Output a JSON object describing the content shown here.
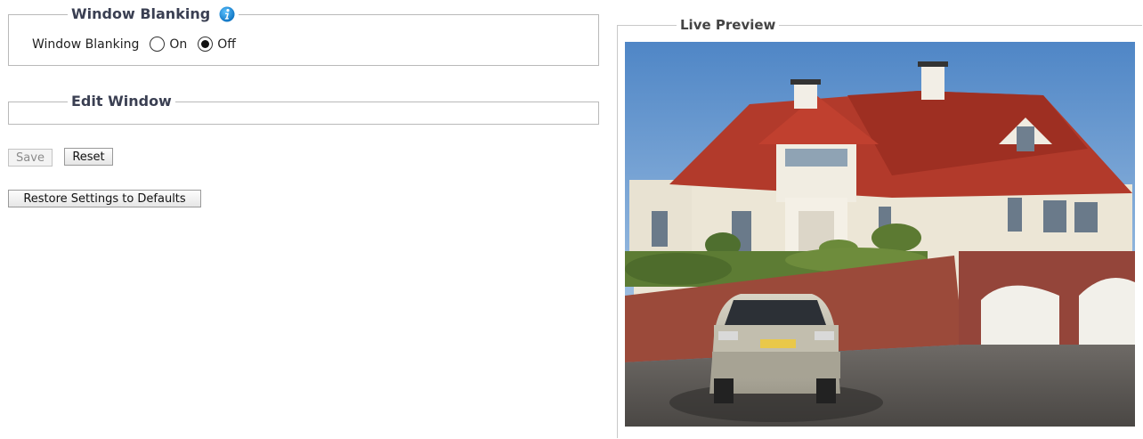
{
  "window_blanking": {
    "legend": "Window Blanking",
    "info_icon": "info-icon",
    "row_label": "Window Blanking",
    "options": [
      {
        "label": "On",
        "selected": false
      },
      {
        "label": "Off",
        "selected": true
      }
    ]
  },
  "edit_window": {
    "legend": "Edit Window"
  },
  "buttons": {
    "save": "Save",
    "reset": "Reset",
    "restore": "Restore Settings to Defaults"
  },
  "live_preview": {
    "legend": "Live Preview"
  },
  "colors": {
    "legend_text": "#3a3f52",
    "info_icon": "#1a8fd6",
    "sky": "#5f8fc4",
    "roof": "#b23a2b",
    "brick": "#9b4a3a",
    "car": "#c9c4b2"
  }
}
